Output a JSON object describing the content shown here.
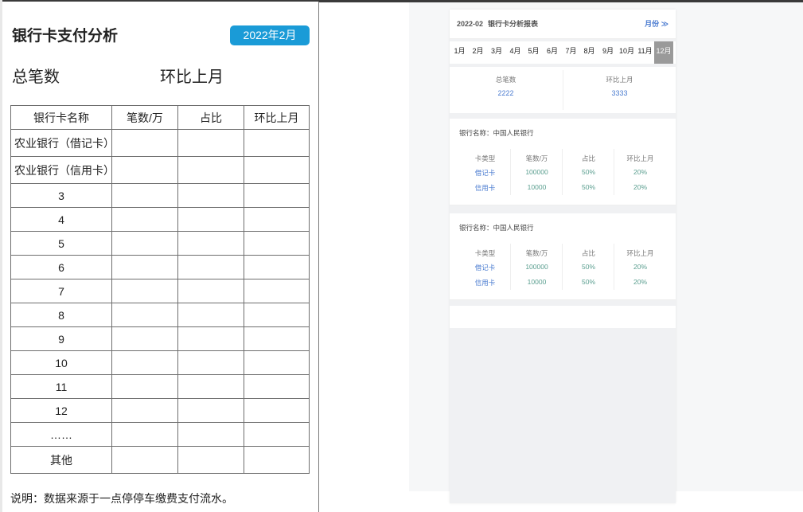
{
  "design": {
    "title": "银行卡支付分析",
    "month_button": "2022年2月",
    "total_label": "总笔数",
    "mom_label": "环比上月",
    "table": {
      "headers": [
        "银行卡名称",
        "笔数/万",
        "占比",
        "环比上月"
      ],
      "rows": [
        "农业银行（借记卡）",
        "农业银行（信用卡）",
        "3",
        "4",
        "5",
        "6",
        "7",
        "8",
        "9",
        "10",
        "11",
        "12",
        "……",
        "其他"
      ]
    },
    "note": "说明：数据来源于一点停停车缴费支付流水。"
  },
  "phone": {
    "header": {
      "date": "2022-02",
      "title": "银行卡分析报表",
      "period_toggle": "月份 ≫"
    },
    "months": [
      "1月",
      "2月",
      "3月",
      "4月",
      "5月",
      "6月",
      "7月",
      "8月",
      "9月",
      "10月",
      "11月",
      "12月"
    ],
    "active_month": "12月",
    "summary": {
      "total_label": "总笔数",
      "total_value": "2222",
      "mom_label": "环比上月",
      "mom_value": "3333"
    },
    "banks": [
      {
        "name_label": "银行名称：",
        "name": "中国人民银行",
        "headers": [
          "卡类型",
          "笔数/万",
          "占比",
          "环比上月"
        ],
        "rows": [
          [
            "借记卡",
            "100000",
            "50%",
            "20%"
          ],
          [
            "信用卡",
            "10000",
            "50%",
            "20%"
          ]
        ]
      },
      {
        "name_label": "银行名称：",
        "name": "中国人民银行",
        "headers": [
          "卡类型",
          "笔数/万",
          "占比",
          "环比上月"
        ],
        "rows": [
          [
            "借记卡",
            "100000",
            "50%",
            "20%"
          ],
          [
            "信用卡",
            "10000",
            "50%",
            "20%"
          ]
        ]
      }
    ]
  },
  "colors": {
    "accent_button": "#1a9bd7",
    "link_blue": "#4a7bd0",
    "value_teal": "#5a9e8f",
    "active_month_bg": "#9a9a9a"
  }
}
